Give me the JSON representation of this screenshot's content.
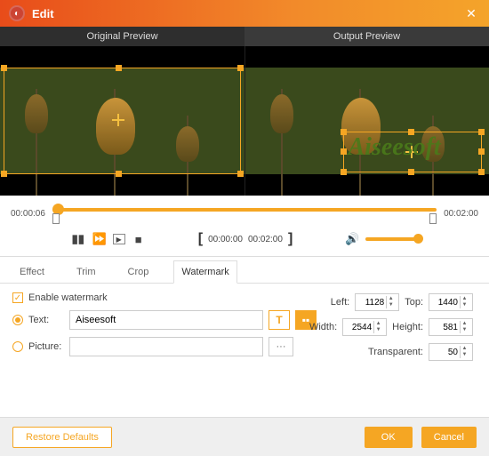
{
  "titlebar": {
    "title": "Edit"
  },
  "preview": {
    "original_label": "Original Preview",
    "output_label": "Output Preview",
    "watermark_preview_text": "Aiseesoft"
  },
  "timeline": {
    "current": "00:00:06",
    "total": "00:02:00"
  },
  "controls": {
    "range_start": "00:00:00",
    "range_end": "00:02:00"
  },
  "tabs": {
    "effect": "Effect",
    "trim": "Trim",
    "crop": "Crop",
    "watermark": "Watermark",
    "active": "watermark"
  },
  "watermark": {
    "enable_label": "Enable watermark",
    "enable_checked": true,
    "type": "text",
    "text_label": "Text:",
    "text_value": "Aiseesoft",
    "picture_label": "Picture:",
    "picture_value": "",
    "left_label": "Left:",
    "left_value": "1128",
    "top_label": "Top:",
    "top_value": "1440",
    "width_label": "Width:",
    "width_value": "2544",
    "height_label": "Height:",
    "height_value": "581",
    "transparent_label": "Transparent:",
    "transparent_value": "50"
  },
  "footer": {
    "restore": "Restore Defaults",
    "ok": "OK",
    "cancel": "Cancel"
  }
}
